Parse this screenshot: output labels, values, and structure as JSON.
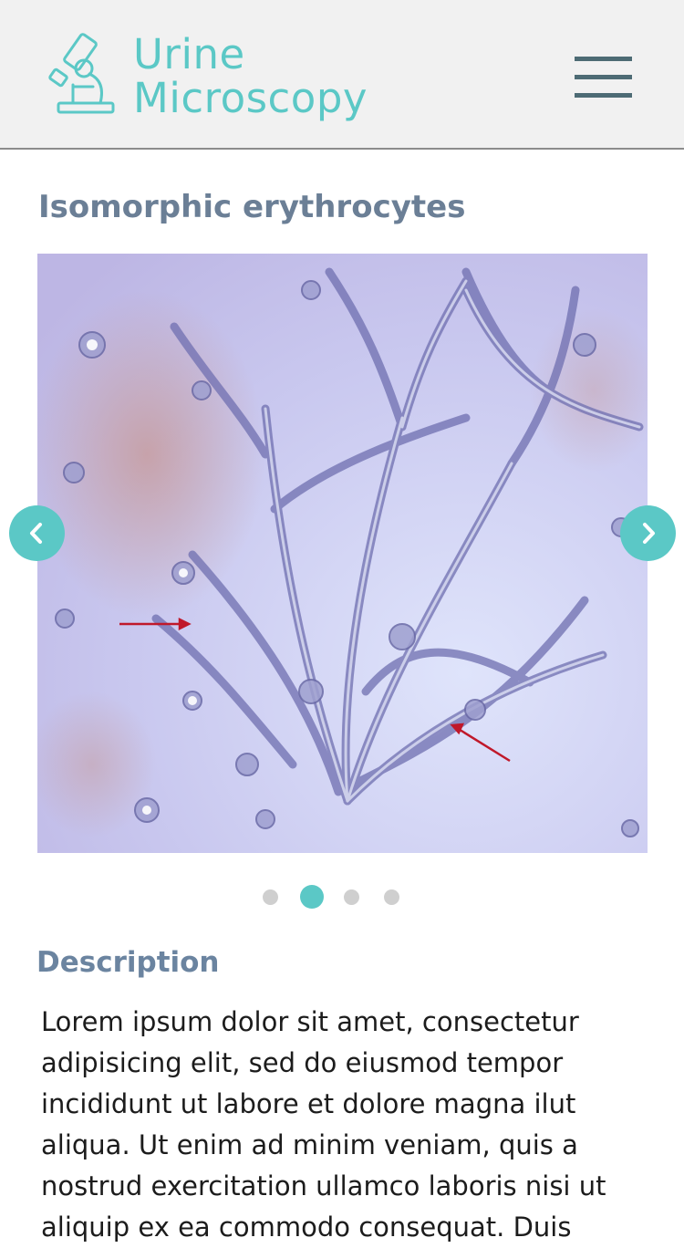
{
  "header": {
    "app_title_line1": "Urine",
    "app_title_line2": "Microscopy",
    "logo_icon": "microscope-icon",
    "menu_icon": "hamburger-menu-icon"
  },
  "page": {
    "title": "Isomorphic erythrocytes"
  },
  "carousel": {
    "prev_icon": "chevron-left-icon",
    "next_icon": "chevron-right-icon",
    "slide_count": 4,
    "active_index": 1
  },
  "description": {
    "heading": "Description",
    "body": "Lorem ipsum dolor sit amet, consectetur adipisicing elit, sed do eiusmod tempor incididunt ut labore et dolore magna ilut aliqua. Ut enim ad minim veniam, quis a nostrud exercitation ullamco laboris nisi ut aliquip ex ea commodo consequat. Duis"
  },
  "colors": {
    "accent": "#5bc8c6",
    "header_bg": "#f1f1f1",
    "menu_bar": "#4d6b74",
    "title_text": "#6b7f96",
    "section_title": "#6b84a0",
    "body_text": "#1c1c1c",
    "dot_inactive": "#cfcfcf"
  }
}
